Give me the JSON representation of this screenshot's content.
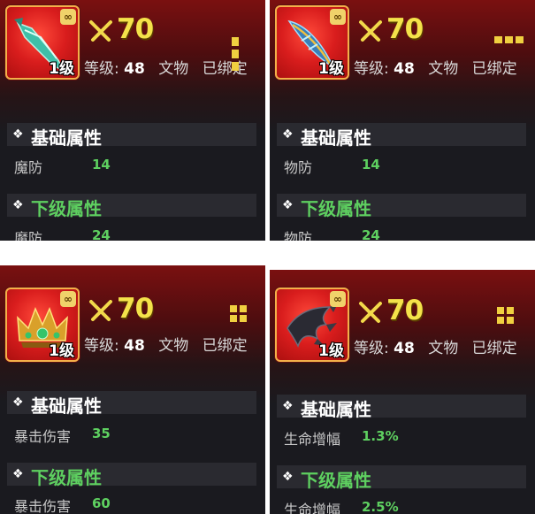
{
  "panels": [
    {
      "item_icon": "jade-dagger-icon",
      "item_level": "1级",
      "power": "70",
      "level_label": "等级:",
      "level_value": "48",
      "kind": "文物",
      "bind_status": "已绑定",
      "grade_icon": "grade-vertical-bars-icon",
      "base_section_title": "基础属性",
      "base_stat_name": "魔防",
      "base_stat_value": "14",
      "sub_section_title": "下级属性",
      "sub_stat_name": "魔防",
      "sub_stat_value": "24"
    },
    {
      "item_icon": "blue-feather-blade-icon",
      "item_level": "1级",
      "power": "70",
      "level_label": "等级:",
      "level_value": "48",
      "kind": "文物",
      "bind_status": "已绑定",
      "grade_icon": "grade-horizontal-bars-icon",
      "base_section_title": "基础属性",
      "base_stat_name": "物防",
      "base_stat_value": "14",
      "sub_section_title": "下级属性",
      "sub_stat_name": "物防",
      "sub_stat_value": "24"
    },
    {
      "item_icon": "emerald-crown-icon",
      "item_level": "1级",
      "power": "70",
      "level_label": "等级:",
      "level_value": "48",
      "kind": "文物",
      "bind_status": "已绑定",
      "grade_icon": "grade-four-squares-icon",
      "base_section_title": "基础属性",
      "base_stat_name": "暴击伤害",
      "base_stat_value": "35",
      "sub_section_title": "下级属性",
      "sub_stat_name": "暴击伤害",
      "sub_stat_value": "60"
    },
    {
      "item_icon": "dark-claw-icon",
      "item_level": "1级",
      "power": "70",
      "level_label": "等级:",
      "level_value": "48",
      "kind": "文物",
      "bind_status": "已绑定",
      "grade_icon": "grade-four-squares-icon",
      "base_section_title": "基础属性",
      "base_stat_name": "生命增幅",
      "base_stat_value": "1.3%",
      "sub_section_title": "下级属性",
      "sub_stat_name": "生命增幅",
      "sub_stat_value": "2.5%"
    }
  ],
  "colors": {
    "power": "#f4e24a",
    "stat_value": "#5ed060",
    "sub_title": "#5ed060",
    "grade": "#f0d040"
  }
}
